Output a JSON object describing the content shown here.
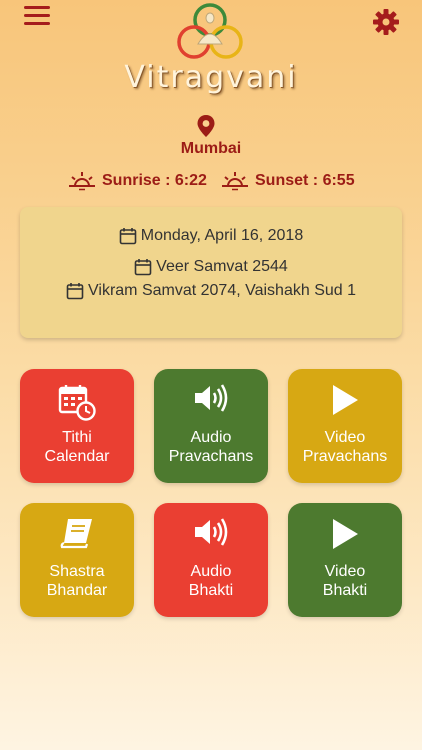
{
  "app": {
    "name": "Vitragvani"
  },
  "location": {
    "city": "Mumbai"
  },
  "sun": {
    "sunrise": "Sunrise : 6:22",
    "sunset": "Sunset : 6:55"
  },
  "dates": {
    "gregorian": "Monday, April 16, 2018",
    "veer_samvat": "Veer Samvat 2544",
    "vikram_samvat": "Vikram Samvat 2074, Vaishakh Sud 1"
  },
  "tiles": [
    {
      "line1": "Tithi",
      "line2": "Calendar",
      "icon": "calendar-clock-icon",
      "color": "#ea3f32"
    },
    {
      "line1": "Audio",
      "line2": "Pravachans",
      "icon": "speaker-icon",
      "color": "#4d7a2f"
    },
    {
      "line1": "Video",
      "line2": "Pravachans",
      "icon": "play-icon",
      "color": "#d7a813"
    },
    {
      "line1": "Shastra",
      "line2": "Bhandar",
      "icon": "book-icon",
      "color": "#d7a813"
    },
    {
      "line1": "Audio",
      "line2": "Bhakti",
      "icon": "speaker-icon",
      "color": "#ea3f32"
    },
    {
      "line1": "Video",
      "line2": "Bhakti",
      "icon": "play-icon",
      "color": "#4d7a2f"
    }
  ],
  "colors": {
    "accent": "#9c1c16",
    "card": "#f0d58d"
  }
}
